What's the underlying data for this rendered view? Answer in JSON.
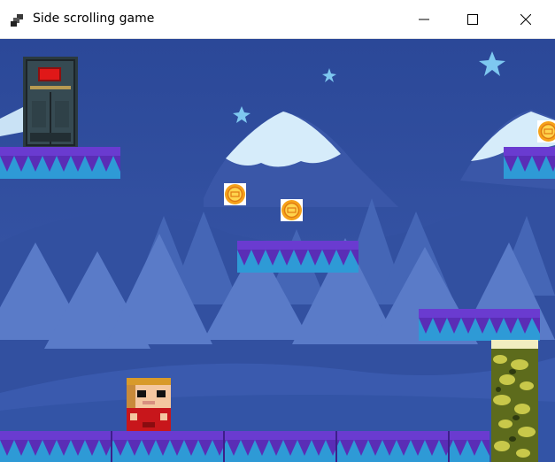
{
  "window": {
    "title": "Side scrolling game"
  },
  "icons": {
    "app": "app-icon",
    "minimize": "minimize-icon",
    "maximize": "maximize-icon",
    "close": "close-icon"
  },
  "colors": {
    "sky": "#2e4b96",
    "platform_top": "#5a2db6",
    "platform_spikes": "#2e9ad6",
    "door_light": "#e01818",
    "coin": "#f6a21a",
    "player_shirt": "#c8161b"
  },
  "scene": {
    "background": "snowy-mountains-and-pine-trees",
    "door": "exit-door",
    "coins_visible": 3,
    "platforms_visible": 5,
    "player": "player-character",
    "obstacle": "mossy-stone-pillar"
  }
}
